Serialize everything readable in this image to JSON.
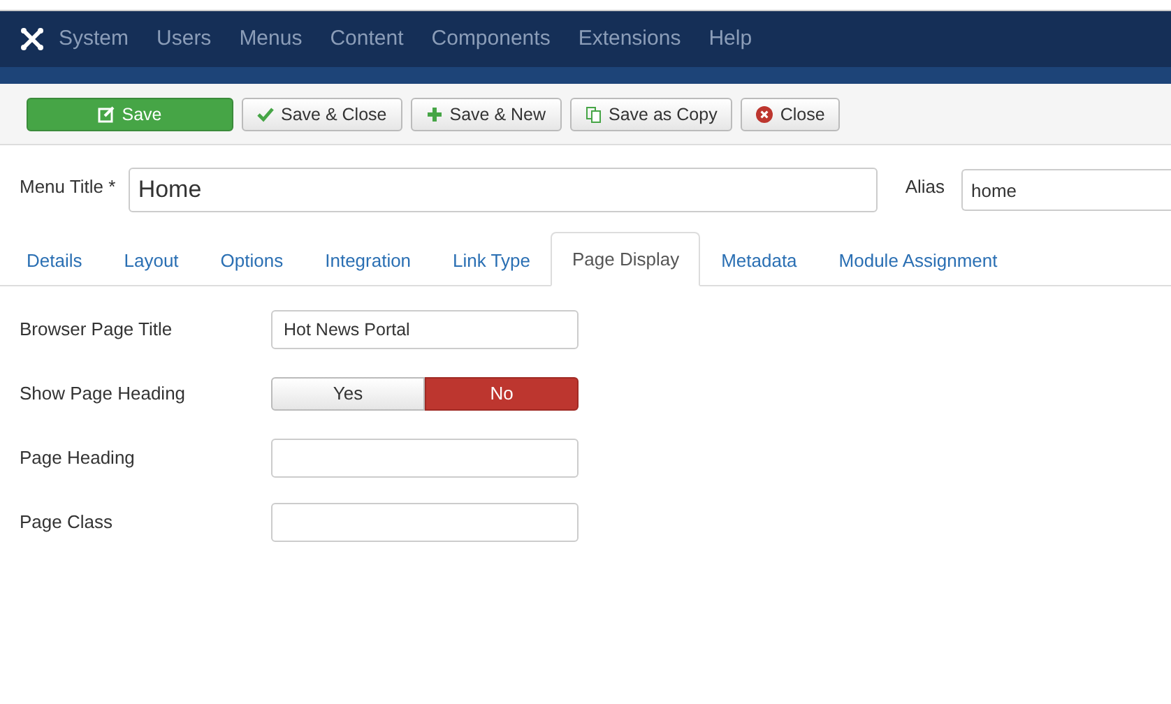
{
  "menubar": {
    "items": [
      "System",
      "Users",
      "Menus",
      "Content",
      "Components",
      "Extensions",
      "Help"
    ]
  },
  "toolbar": {
    "buttons": [
      {
        "label": "Save",
        "kind": "primary"
      },
      {
        "label": "Save & Close",
        "kind": "check"
      },
      {
        "label": "Save & New",
        "kind": "plus"
      },
      {
        "label": "Save as Copy",
        "kind": "copy"
      },
      {
        "label": "Close",
        "kind": "close"
      }
    ]
  },
  "title_row": {
    "label": "Menu Title *",
    "value": "Home",
    "alias_label": "Alias",
    "alias_value": "home"
  },
  "tabs": [
    {
      "label": "Details",
      "selected": false
    },
    {
      "label": "Layout",
      "selected": false
    },
    {
      "label": "Options",
      "selected": false
    },
    {
      "label": "Integration",
      "selected": false
    },
    {
      "label": "Link Type",
      "selected": false
    },
    {
      "label": "Page Display",
      "selected": true
    },
    {
      "label": "Metadata",
      "selected": false
    },
    {
      "label": "Module Assignment",
      "selected": false
    }
  ],
  "fields": [
    {
      "kind": "text",
      "label": "Browser Page Title",
      "value": "Hot News Portal"
    },
    {
      "kind": "toggle",
      "label": "Show Page Heading",
      "options": [
        {
          "label": "Yes",
          "selected": false
        },
        {
          "label": "No",
          "selected": true
        }
      ]
    },
    {
      "kind": "text",
      "label": "Page Heading"
    },
    {
      "kind": "text",
      "label": "Page Class"
    }
  ]
}
